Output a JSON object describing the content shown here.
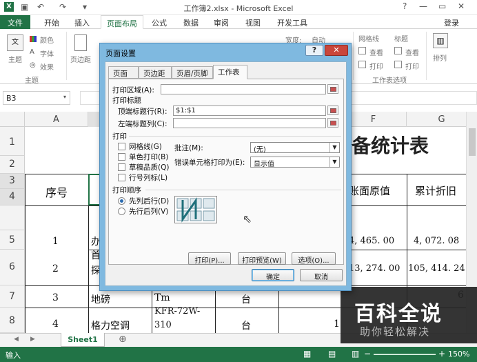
{
  "window": {
    "title": "工作簿2.xlsx - Microsoft Excel",
    "help": "?",
    "minimize": "—",
    "restore": "▭",
    "close": "✕"
  },
  "ribbon_tabs": [
    "文件",
    "开始",
    "插入",
    "页面布局",
    "公式",
    "数据",
    "审阅",
    "视图",
    "开发工具"
  ],
  "login": "登录",
  "ribbon": {
    "themes_label": "主题",
    "colors": "颜色",
    "fonts": "字体",
    "effects": "效果",
    "margins": "页边距",
    "width_label": "宽度:",
    "width_value": "自动",
    "gridlines_label": "网格线",
    "headings_label": "标题",
    "view1": "查看",
    "view2": "查看",
    "print1": "打印",
    "print2": "打印",
    "sheet_options_group": "工作表选项",
    "arrange": "排列",
    "theme_group": "主题"
  },
  "namebox": "B3",
  "columns": [
    "A",
    "F",
    "G"
  ],
  "rows": [
    "1",
    "2",
    "3",
    "4",
    "5",
    "6",
    "7",
    "8"
  ],
  "sheet": {
    "title_fragment": "备统计表",
    "header_seq": "序号",
    "header_orig_value": "账面原值",
    "header_accum_dep": "累计折旧",
    "r5": {
      "seq": "1",
      "b": "办",
      "f": "4, 465. 00",
      "g": "4, 072. 08"
    },
    "r6": {
      "seq": "2",
      "b1": "首",
      "b2": "探",
      "f": "13, 274. 00",
      "g": "105, 414. 24"
    },
    "r7": {
      "seq": "3",
      "b": "地磅",
      "c": "Tm",
      "d": "台"
    },
    "r8": {
      "seq": "4",
      "b": "格力空调",
      "c1": "KFR-72W-",
      "c2": "310",
      "d": "台",
      "e": "1",
      "g": "6"
    }
  },
  "sheet_tab": "Sheet1",
  "status": {
    "mode": "输入",
    "zoom": "150%"
  },
  "dialog": {
    "title": "页面设置",
    "help": "?",
    "close": "✕",
    "tabs": [
      "页面",
      "页边距",
      "页眉/页脚",
      "工作表"
    ],
    "print_area_label": "打印区域(A):",
    "print_titles_label": "打印标题",
    "top_rows_label": "顶端标题行(R):",
    "top_rows_value": "$1:$1",
    "left_cols_label": "左端标题列(C):",
    "print_label": "打印",
    "gridlines": "网格线(G)",
    "black_white": "单色打印(B)",
    "draft": "草稿品质(Q)",
    "row_col_headings": "行号列标(L)",
    "comments_label": "批注(M):",
    "comments_value": "(无)",
    "errors_label": "错误单元格打印为(E):",
    "errors_value": "显示值",
    "page_order_label": "打印顺序",
    "down_then_over": "先列后行(D)",
    "over_then_down": "先行后列(V)",
    "print_btn": "打印(P)...",
    "preview_btn": "打印预览(W)",
    "options_btn": "选项(O)...",
    "ok": "确定",
    "cancel": "取消"
  },
  "watermark": {
    "main": "百科全说",
    "sub": "助你轻松解决"
  }
}
